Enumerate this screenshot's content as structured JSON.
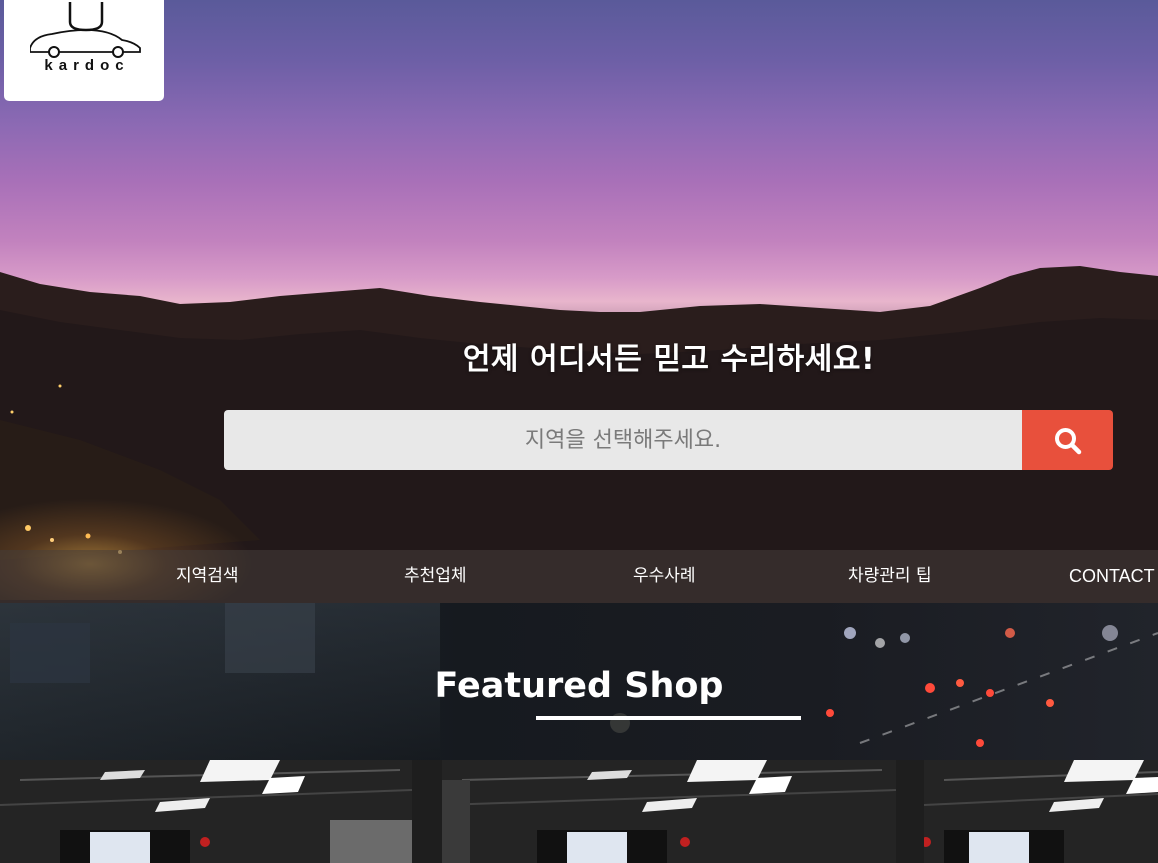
{
  "brand": {
    "logo_text": "kardoc"
  },
  "hero": {
    "headline": "언제 어디서든 믿고 수리하세요!",
    "search": {
      "placeholder": "지역을 선택해주세요.",
      "button_icon": "search-icon"
    }
  },
  "nav": {
    "items": [
      {
        "label": "지역검색"
      },
      {
        "label": "추천업체"
      },
      {
        "label": "우수사례"
      },
      {
        "label": "차량관리 팁"
      },
      {
        "label": "CONTACT"
      }
    ]
  },
  "featured": {
    "title": "Featured Shop"
  },
  "colors": {
    "accent": "#e8503c",
    "search_bg": "#e8e8e8",
    "text": "#ffffff"
  }
}
